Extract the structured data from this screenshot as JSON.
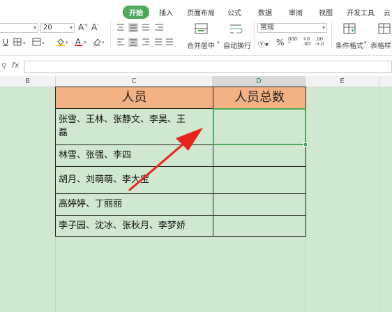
{
  "ribbon": {
    "tabs": [
      {
        "label": "开始",
        "active": true
      },
      {
        "label": "插入"
      },
      {
        "label": "页面布局"
      },
      {
        "label": "公式"
      },
      {
        "label": "数据"
      },
      {
        "label": "审阅"
      },
      {
        "label": "视图"
      },
      {
        "label": "开发工具"
      },
      {
        "label": "云"
      }
    ],
    "font_size": "20",
    "number_format": "常规",
    "merge_center_label": "合并居中",
    "wrap_text_label": "自动换行",
    "cond_format_label": "条件格式",
    "table_style_label": "表格样"
  },
  "formula_bar": {
    "fx_label": "fx",
    "value": ""
  },
  "sheet": {
    "columns": [
      "B",
      "C",
      "D",
      "E"
    ],
    "selected_column": "D",
    "table": {
      "headers": [
        "人员",
        "人员总数"
      ],
      "rows": [
        {
          "names_line1": "张雪、王林、张静文、李昊、王",
          "names_line2": "磊",
          "count": ""
        },
        {
          "names_line1": "林雪、张强、李四",
          "count": ""
        },
        {
          "names_line1": "胡月、刘萌萌、李大宝",
          "count": ""
        },
        {
          "names_line1": "高婷婷、丁丽丽",
          "count": ""
        },
        {
          "names_line1": "李子园、沈冰、张秋月、李梦娇",
          "count": ""
        }
      ]
    }
  },
  "colors": {
    "accent": "#4eaa5a",
    "header_fill": "#f4b183",
    "sheet_bg": "#cfe8cf",
    "arrow": "#e8241c"
  }
}
